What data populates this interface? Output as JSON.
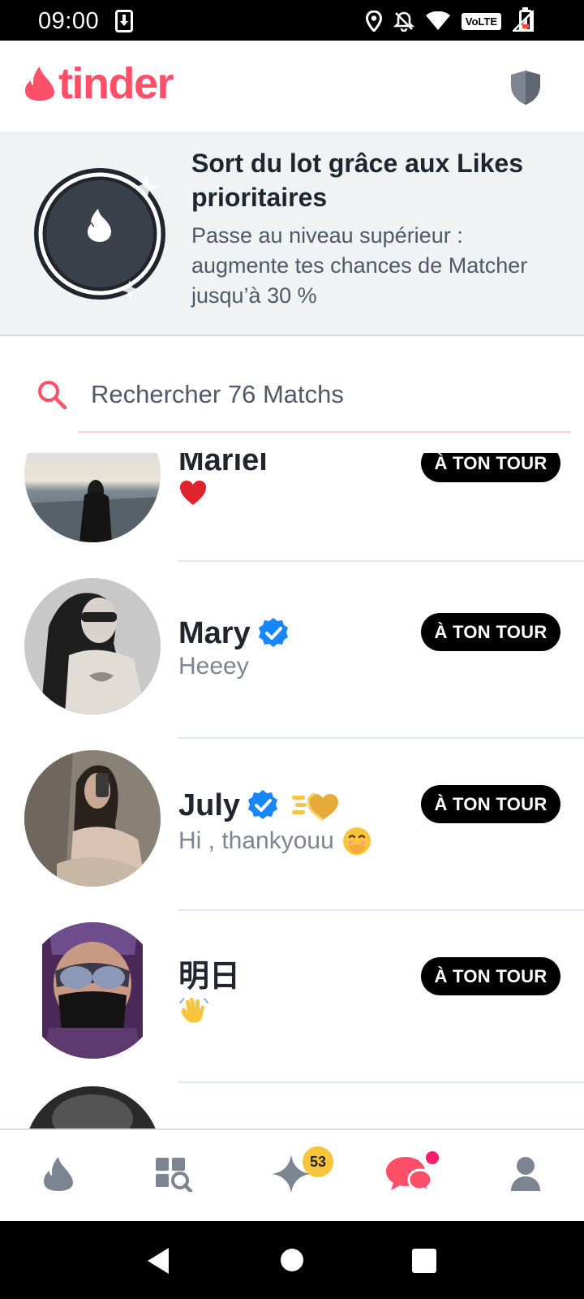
{
  "status_bar": {
    "time": "09:00",
    "network_badge": "VoLTE",
    "icons": [
      "download-icon",
      "location-icon",
      "notifications-off-icon",
      "wifi-icon",
      "signal-icon",
      "battery-icon"
    ]
  },
  "header": {
    "logo_text": "tinder",
    "brand_color": "#fd5068",
    "shield_icon": "shield-icon"
  },
  "promo": {
    "title": "Sort du lot grâce aux Likes prioritaires",
    "description": "Passe au niveau supérieur : augmente tes chances de Matcher jusqu’à 30 %"
  },
  "search": {
    "placeholder": "Rechercher 76 Matchs",
    "value": ""
  },
  "matches": [
    {
      "name": "Mariel",
      "preview_emoji": "❤️",
      "verified": false,
      "badge": "À TON TOUR"
    },
    {
      "name": "Mary",
      "preview": "Heeey",
      "verified": true,
      "badge": "À TON TOUR"
    },
    {
      "name": "July",
      "preview": "Hi , thankyouu",
      "preview_emoji": "🤭",
      "verified": true,
      "super_like": true,
      "badge": "À TON TOUR"
    },
    {
      "name": "明日",
      "preview_emoji": "👋",
      "verified": false,
      "badge": "À TON TOUR"
    }
  ],
  "bottom_nav": {
    "items": [
      "flame-icon",
      "explore-icon",
      "gold-star-icon",
      "messages-icon",
      "profile-icon"
    ],
    "gold_badge_count": "53",
    "active": "messages-icon"
  },
  "system_nav": [
    "back-icon",
    "home-icon",
    "recents-icon"
  ]
}
